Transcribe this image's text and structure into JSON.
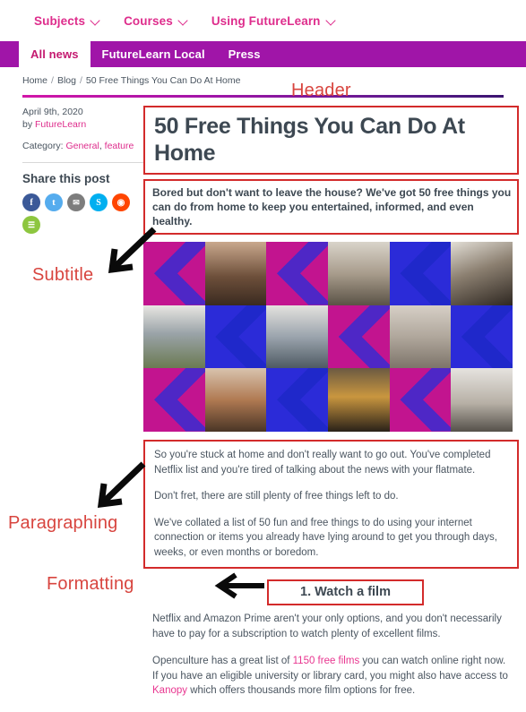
{
  "topnav": {
    "items": [
      {
        "label": "Subjects",
        "icon": "chevron-down-icon"
      },
      {
        "label": "Courses",
        "icon": "chevron-down-icon"
      },
      {
        "label": "Using FutureLearn",
        "icon": "chevron-down-icon"
      }
    ]
  },
  "tabbar": {
    "tabs": [
      {
        "label": "All news",
        "active": true
      },
      {
        "label": "FutureLearn Local",
        "active": false
      },
      {
        "label": "Press",
        "active": false
      }
    ],
    "background": "#A015A8",
    "active_text": "#C41A70"
  },
  "breadcrumb": {
    "items": [
      "Home",
      "Blog",
      "50 Free Things You Can Do At Home"
    ],
    "separator": "/"
  },
  "sidebar": {
    "date": "April 9th, 2020",
    "by_prefix": "by ",
    "author": "FutureLearn",
    "category_prefix": "Category: ",
    "categories": [
      "General",
      "feature"
    ],
    "share_title": "Share this post",
    "share_icons": [
      {
        "name": "facebook-share-icon",
        "glyph": "f",
        "color": "#3B5998"
      },
      {
        "name": "twitter-share-icon",
        "glyph": "t",
        "color": "#55ACEE"
      },
      {
        "name": "email-share-icon",
        "glyph": "✉",
        "color": "#7D7D7D"
      },
      {
        "name": "skype-share-icon",
        "glyph": "S",
        "color": "#00AFF0"
      },
      {
        "name": "reddit-share-icon",
        "glyph": "◉",
        "color": "#FF4500"
      },
      {
        "name": "more-share-icon",
        "glyph": "☰",
        "color": "#8DC63F"
      }
    ]
  },
  "article": {
    "title": "50 Free Things You Can Do At Home",
    "subtitle": "Bored but don't want to leave the house? We've got 50 free things you can do from home to keep you entertained, informed, and even healthy.",
    "paragraphs": [
      "So you're stuck at home and don't really want to go out. You've completed Netflix list and you're tired of talking about the news with your flatmate.",
      "Don't fret, there are still plenty of free things left to do.",
      "We've collated a list of 50 fun and free things to do using your internet connection or items you already have lying around to get you through days, weeks, or even months or boredom."
    ],
    "heading": "1. Watch a film",
    "tail_paragraph_1": "Netflix and Amazon Prime aren't your only options, and you don't necessarily have to pay for a subscription to watch plenty of excellent films.",
    "tail_paragraph_2": {
      "before": "Openculture has a great list of ",
      "link_1": "1150 free films",
      "middle": " you can watch online right now. If you have an eligible university or library card, you might also have access to ",
      "link_2": "Kanopy",
      "after": " which offers thousands more film options for free."
    }
  },
  "collage": {
    "alt": "grid of people doing activities at home",
    "cells": [
      "placeholder-magenta",
      "photo-guitar",
      "placeholder-magenta",
      "photo-museum",
      "placeholder-blue",
      "photo-tv",
      "photo-cooking",
      "placeholder-blue",
      "photo-bike-repair",
      "placeholder-magenta",
      "photo-yoga",
      "placeholder-blue",
      "placeholder-magenta",
      "photo-phone-call",
      "placeholder-blue",
      "photo-desk-lamp",
      "placeholder-magenta",
      "photo-camera"
    ]
  },
  "annotations": {
    "color": "#D8453F",
    "labels": [
      {
        "text": "Header",
        "name": "annotation-header"
      },
      {
        "text": "Subtitle",
        "name": "annotation-subtitle"
      },
      {
        "text": "Paragraphing",
        "name": "annotation-paragraphing"
      },
      {
        "text": "Formatting",
        "name": "annotation-formatting"
      }
    ],
    "box_color": "#D32B2B"
  }
}
